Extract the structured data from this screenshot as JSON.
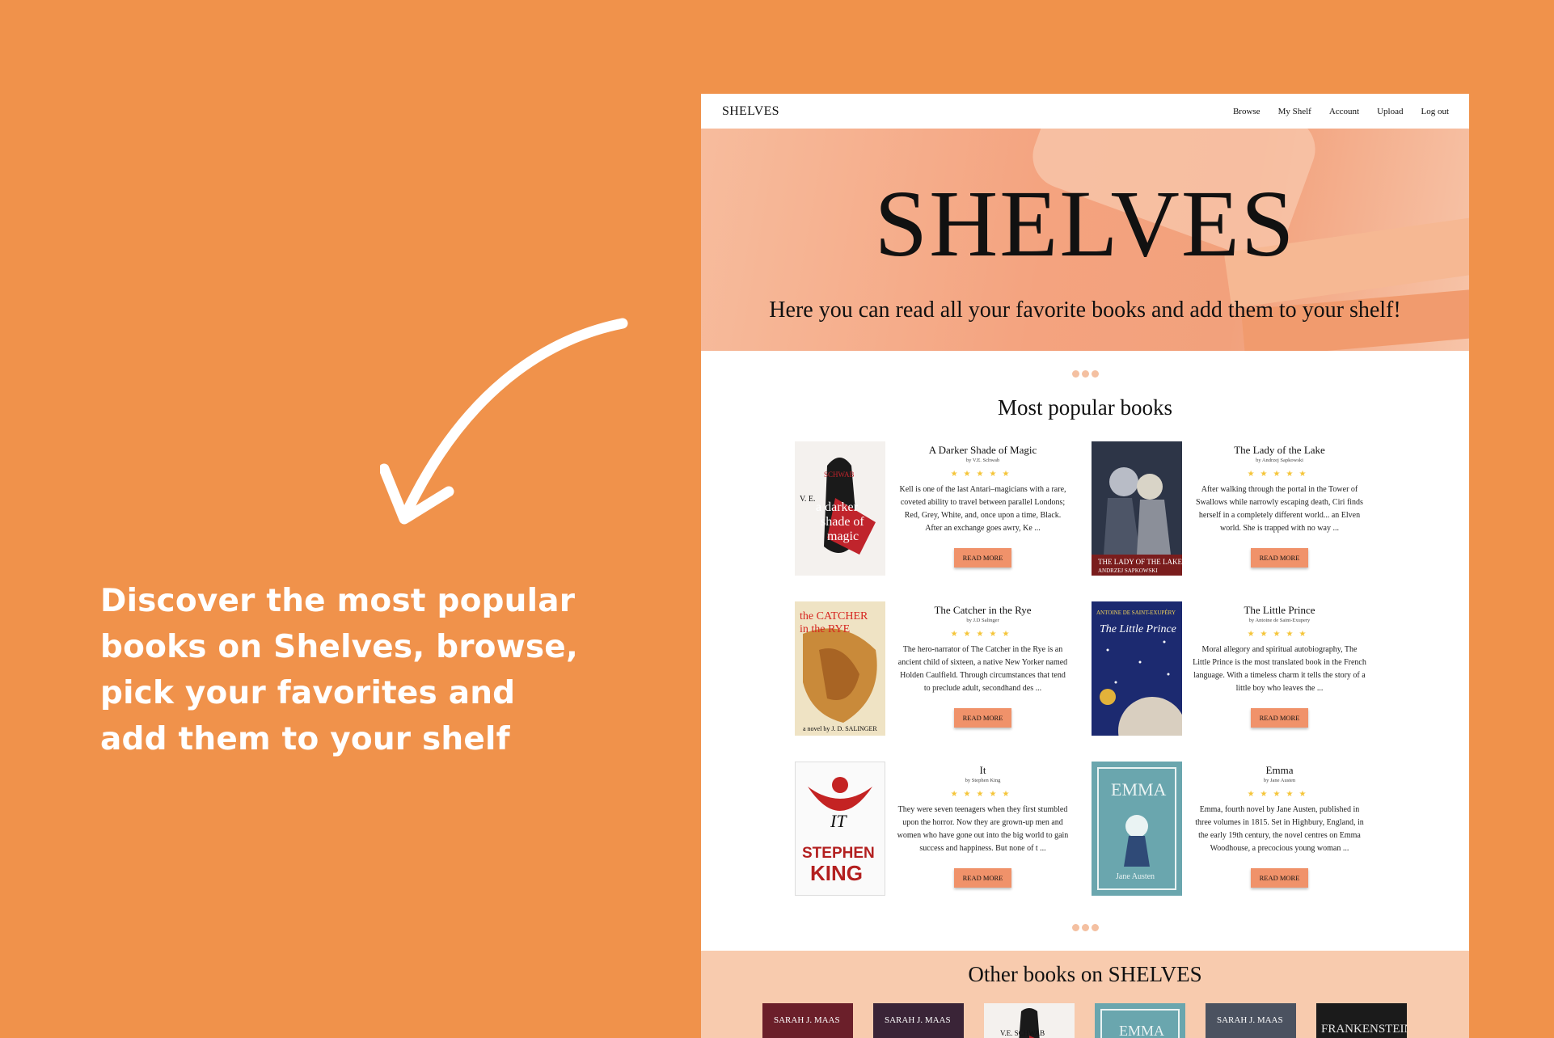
{
  "promo": {
    "text": "Discover the most popular books on Shelves, browse, pick your favorites and add them to your shelf"
  },
  "site": {
    "logo": "SHELVES",
    "nav": [
      "Browse",
      "My Shelf",
      "Account",
      "Upload",
      "Log out"
    ],
    "hero": {
      "title": "SHELVES",
      "subtitle": "Here you can read all your favorite books and add them to your shelf!"
    },
    "popular_title": "Most popular books",
    "read_more": "READ MORE",
    "books": [
      {
        "title": "A Darker Shade of Magic",
        "author": "by V.E. Schwab",
        "rating": 5,
        "stars": "★★★★★",
        "description": "Kell is one of the last Antari–magicians with a rare, coveted ability to travel between parallel Londons; Red, Grey, White, and, once upon a time, Black. After an exchange goes awry, Ke ...",
        "cover_lines": [
          "V. E. SCHWAB",
          "a darker shade of magic"
        ],
        "cover_icon": "darker-shade-cover"
      },
      {
        "title": "The Lady of the Lake",
        "author": "by Andrzej Sapkowski",
        "rating": 5,
        "stars": "★★★★★",
        "description": "After walking through the portal in the Tower of Swallows while narrowly escaping death, Ciri finds herself in a completely different world... an Elven world. She is trapped with no way ...",
        "cover_lines": [
          "THE LADY OF THE LAKE",
          "ANDRZEJ SAPKOWSKI"
        ],
        "cover_icon": "lady-of-lake-cover"
      },
      {
        "title": "The Catcher in the Rye",
        "author": "by J.D Salinger",
        "rating": 5,
        "stars": "★★★★★",
        "description": "The hero-narrator of The Catcher in the Rye is an ancient child of sixteen, a native New Yorker named Holden Caulfield. Through circumstances that tend to preclude adult, secondhand des ...",
        "cover_lines": [
          "the CATCHER in the RYE",
          "a novel by J. D. SALINGER"
        ],
        "cover_icon": "catcher-cover"
      },
      {
        "title": "The Little Prince",
        "author": "by Antoine de Saint-Exupery",
        "rating": 5,
        "stars": "★★★★★",
        "description": "Moral allegory and spiritual autobiography, The Little Prince is the most translated book in the French language. With a timeless charm it tells the story of a little boy who leaves the ...",
        "cover_lines": [
          "ANTOINE DE SAINT-EXUPÉRY",
          "The Little Prince"
        ],
        "cover_icon": "little-prince-cover"
      },
      {
        "title": "It",
        "author": "by Stephen King",
        "rating": 5,
        "stars": "★★★★★",
        "description": "They were seven teenagers when they first stumbled upon the horror. Now they are grown-up men and women who have gone out into the big world to gain success and happiness. But none of t ...",
        "cover_lines": [
          "IT",
          "STEPHEN KING"
        ],
        "cover_icon": "it-cover"
      },
      {
        "title": "Emma",
        "author": "by Jane Austen",
        "rating": 5,
        "stars": "★★★★★",
        "description": "Emma, fourth novel by Jane Austen, published in three volumes in 1815. Set in Highbury, England, in the early 19th century, the novel centres on Emma Woodhouse, a precocious young woman ...",
        "cover_lines": [
          "EMMA",
          "Jane Austen"
        ],
        "cover_icon": "emma-cover"
      }
    ],
    "other_title": "Other books on SHELVES",
    "other_books": [
      {
        "label": "SARAH J. MAAS",
        "icon": "maas-cover"
      },
      {
        "label": "SARAH J. MAAS",
        "icon": "maas-cover"
      },
      {
        "label": "V.E. SCHWAB",
        "icon": "darker-shade-cover"
      },
      {
        "label": "EMMA",
        "icon": "emma-cover"
      },
      {
        "label": "SARAH J. MAAS",
        "icon": "maas-cover"
      },
      {
        "label": "FRANKENSTEIN",
        "icon": "frankenstein-cover"
      }
    ],
    "colors": {
      "page_background": "#F0924B",
      "accent": "#F0926A",
      "star": "#F5C53A",
      "dot": "#F4C0A1",
      "other_section": "#F8CBAE"
    }
  }
}
